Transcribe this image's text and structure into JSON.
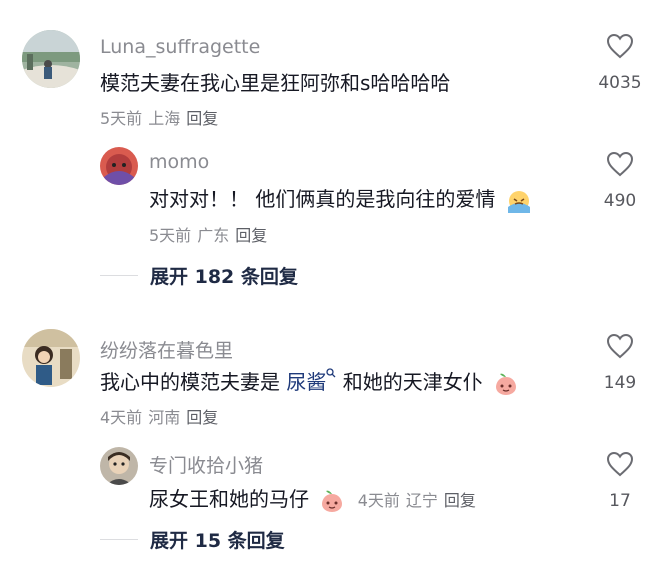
{
  "comments": [
    {
      "username": "Luna_suffragette",
      "text": "模范夫妻在我心里是狂阿弥和s哈哈哈哈",
      "time": "5天前",
      "location": "上海",
      "reply_label": "回复",
      "likes": "4035",
      "replies": [
        {
          "username": "momo",
          "text": "对对对！！ 他们俩真的是我向往的爱情",
          "time": "5天前",
          "location": "广东",
          "reply_label": "回复",
          "likes": "490"
        }
      ],
      "expand_label": "展开 182 条回复"
    },
    {
      "username": "纷纷落在暮色里",
      "text_before": "我心中的模范夫妻是 ",
      "text_link": "尿酱",
      "text_after": " 和她的天津女仆",
      "time": "4天前",
      "location": "河南",
      "reply_label": "回复",
      "likes": "149",
      "replies": [
        {
          "username": "专门收拾小猪",
          "text": "尿女王和她的马仔",
          "time": "4天前",
          "location": "辽宁",
          "reply_label": "回复",
          "likes": "17"
        }
      ],
      "expand_label": "展开 15 条回复"
    }
  ],
  "colors": {
    "username": "#8a8b91",
    "text": "#161823",
    "link": "#1f3a7a",
    "expand": "#1f2a44"
  }
}
